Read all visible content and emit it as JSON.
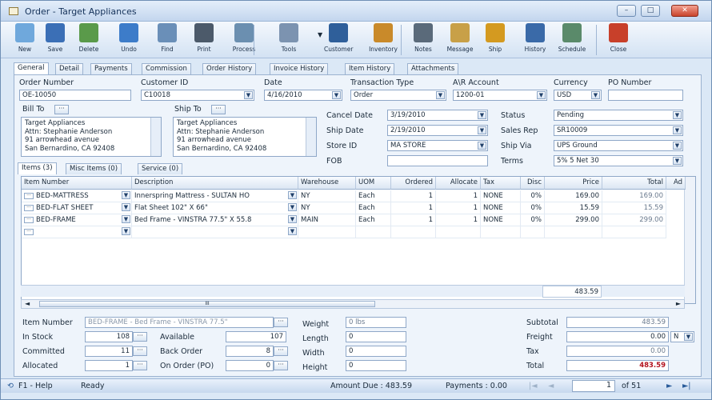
{
  "window": {
    "title": "Order - Target Appliances"
  },
  "toolbar": [
    {
      "name": "new",
      "label": "New",
      "color": "#6fa8dc"
    },
    {
      "name": "save",
      "label": "Save",
      "color": "#3b6fb6"
    },
    {
      "name": "delete",
      "label": "Delete",
      "color": "#5a9a4a"
    },
    {
      "name": "undo",
      "label": "Undo",
      "color": "#3d7cc9"
    },
    {
      "name": "find",
      "label": "Find",
      "color": "#6a8fb8"
    },
    {
      "name": "print",
      "label": "Print",
      "color": "#4c5a6a"
    },
    {
      "name": "process",
      "label": "Process",
      "color": "#6b8fb0"
    },
    {
      "name": "tools",
      "label": "Tools",
      "color": "#7c93b0"
    },
    {
      "name": "customer",
      "label": "Customer",
      "color": "#2f5f9a"
    },
    {
      "name": "inventory",
      "label": "Inventory",
      "color": "#c98a2a"
    },
    {
      "name": "notes",
      "label": "Notes",
      "color": "#5a6a7a"
    },
    {
      "name": "message",
      "label": "Message",
      "color": "#c8a048"
    },
    {
      "name": "ship",
      "label": "Ship",
      "color": "#d49a20"
    },
    {
      "name": "history",
      "label": "History",
      "color": "#3a6aa8"
    },
    {
      "name": "schedule",
      "label": "Schedule",
      "color": "#5a8a6a"
    },
    {
      "name": "close",
      "label": "Close",
      "color": "#c8402a"
    }
  ],
  "tabs": [
    "General",
    "Detail",
    "Payments",
    "Commission",
    "Order History",
    "Invoice History",
    "Item History",
    "Attachments"
  ],
  "header": {
    "order_number_label": "Order Number",
    "order_number": "OE-10050",
    "customer_id_label": "Customer ID",
    "customer_id": "C10018",
    "date_label": "Date",
    "date": "4/16/2010",
    "transaction_type_label": "Transaction Type",
    "transaction_type": "Order",
    "ar_account_label": "A\\R Account",
    "ar_account": "1200-01",
    "currency_label": "Currency",
    "currency": "USD",
    "po_number_label": "PO Number",
    "po_number": ""
  },
  "bill_to": {
    "label": "Bill To",
    "lines": [
      "Target Appliances",
      "Attn: Stephanie Anderson",
      "91 arrowhead avenue",
      "San Bernardino, CA 92408"
    ]
  },
  "ship_to": {
    "label": "Ship To",
    "lines": [
      "Target Appliances",
      "Attn: Stephanie Anderson",
      "91 arrowhead avenue",
      "San Bernardino, CA 92408"
    ]
  },
  "fields": {
    "cancel_date_label": "Cancel Date",
    "cancel_date": "3/19/2010",
    "ship_date_label": "Ship Date",
    "ship_date": "2/19/2010",
    "store_id_label": "Store ID",
    "store_id": "MA STORE",
    "fob_label": "FOB",
    "fob": "",
    "status_label": "Status",
    "status": "Pending",
    "sales_rep_label": "Sales Rep",
    "sales_rep": "SR10009",
    "ship_via_label": "Ship Via",
    "ship_via": "UPS Ground",
    "terms_label": "Terms",
    "terms": "5% 5 Net 30"
  },
  "item_tabs": [
    "Items (3)",
    "Misc Items (0)",
    "Service (0)"
  ],
  "grid": {
    "columns": [
      "Item Number",
      "Description",
      "Warehouse",
      "UOM",
      "Ordered",
      "Allocate",
      "Tax",
      "Disc",
      "Price",
      "Total",
      "Ad"
    ],
    "rows": [
      [
        "BED-MATTRESS",
        "Innerspring Mattress - SULTAN HO",
        "NY",
        "Each",
        "1",
        "1",
        "NONE",
        "0%",
        "169.00",
        "169.00"
      ],
      [
        "BED-FLAT SHEET",
        "Flat Sheet 102\" X 66\"",
        "NY",
        "Each",
        "1",
        "1",
        "NONE",
        "0%",
        "15.59",
        "15.59"
      ],
      [
        "BED-FRAME",
        "Bed Frame - VINSTRA 77.5\" X 55.8",
        "MAIN",
        "Each",
        "1",
        "1",
        "NONE",
        "0%",
        "299.00",
        "299.00"
      ]
    ],
    "total": "483.59",
    "scroll_label": "III"
  },
  "detail": {
    "item_number_label": "Item Number",
    "item_number": "BED-FRAME - Bed Frame - VINSTRA 77.5\"",
    "in_stock_label": "In Stock",
    "in_stock": "108",
    "committed_label": "Committed",
    "committed": "11",
    "allocated_label": "Allocated",
    "allocated": "1",
    "available_label": "Available",
    "available": "107",
    "back_order_label": "Back Order",
    "back_order": "8",
    "on_order_label": "On Order (PO)",
    "on_order": "0",
    "weight_label": "Weight",
    "weight": "0 lbs",
    "length_label": "Length",
    "length": "0",
    "width_label": "Width",
    "width": "0",
    "height_label": "Height",
    "height": "0"
  },
  "totals": {
    "subtotal_label": "Subtotal",
    "subtotal": "483.59",
    "freight_label": "Freight",
    "freight": "0.00",
    "freight_code": "N",
    "tax_label": "Tax",
    "tax": "0.00",
    "total_label": "Total",
    "total": "483.59"
  },
  "status": {
    "help": "F1 - Help",
    "ready": "Ready",
    "amount_due": "Amount Due : 483.59",
    "payments": "Payments : 0.00",
    "page": "1",
    "of": "of 51"
  }
}
